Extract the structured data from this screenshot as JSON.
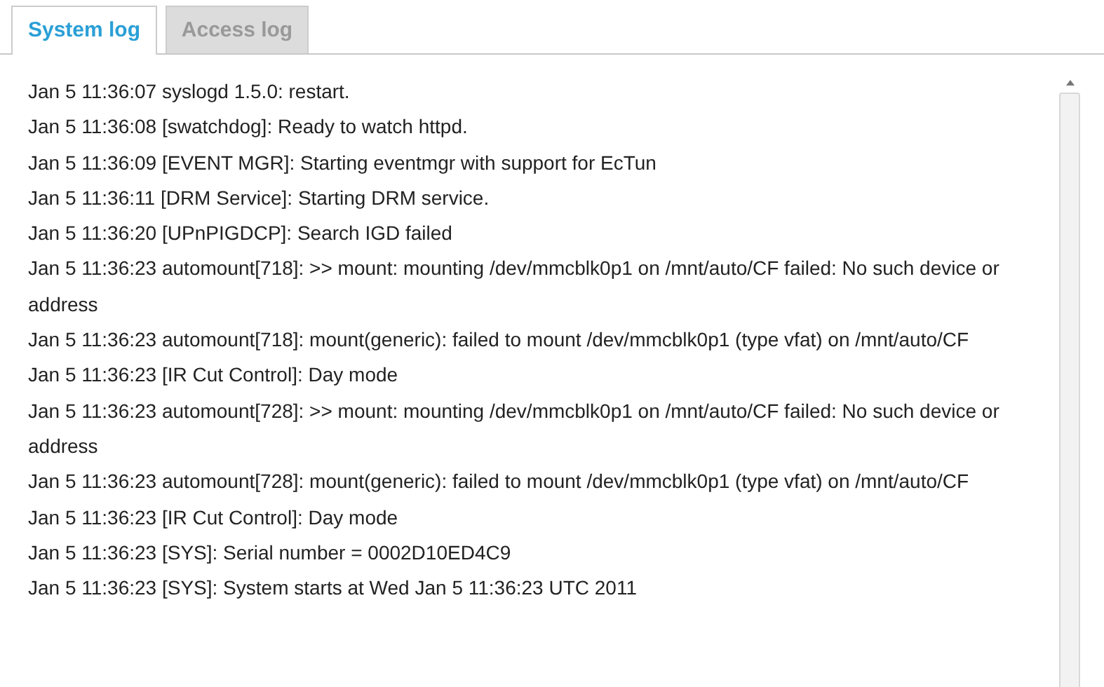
{
  "tabs": [
    {
      "label": "System log",
      "selected": true
    },
    {
      "label": "Access log",
      "selected": false
    }
  ],
  "log": {
    "entries": [
      "Jan 5 11:36:07 syslogd 1.5.0: restart.",
      "Jan 5 11:36:08 [swatchdog]: Ready to watch httpd.",
      "Jan 5 11:36:09 [EVENT MGR]: Starting eventmgr with support for EcTun",
      "Jan 5 11:36:11 [DRM Service]: Starting DRM service.",
      "Jan 5 11:36:20 [UPnPIGDCP]: Search IGD failed",
      "Jan 5 11:36:23 automount[718]: >> mount: mounting /dev/mmcblk0p1 on /mnt/auto/CF failed: No such device or address",
      "Jan 5 11:36:23 automount[718]: mount(generic): failed to mount /dev/mmcblk0p1 (type vfat) on /mnt/auto/CF",
      "Jan 5 11:36:23 [IR Cut Control]: Day mode",
      "Jan 5 11:36:23 automount[728]: >> mount: mounting /dev/mmcblk0p1 on /mnt/auto/CF failed: No such device or address",
      "Jan 5 11:36:23 automount[728]: mount(generic): failed to mount /dev/mmcblk0p1 (type vfat) on /mnt/auto/CF",
      "Jan 5 11:36:23 [IR Cut Control]: Day mode",
      "Jan 5 11:36:23 [SYS]: Serial number = 0002D10ED4C9",
      "Jan 5 11:36:23 [SYS]: System starts at Wed Jan 5 11:36:23 UTC 2011"
    ]
  }
}
